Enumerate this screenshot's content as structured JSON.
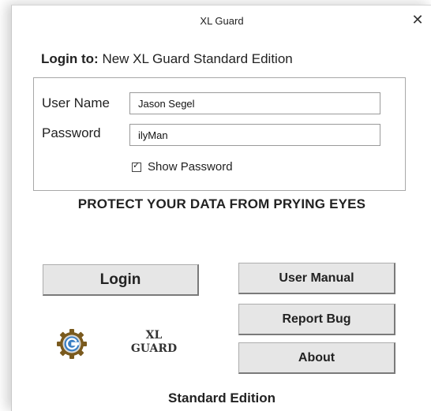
{
  "window": {
    "title": "XL Guard",
    "close_glyph": "✕"
  },
  "login_to": {
    "label": "Login to:",
    "target": "New XL Guard Standard Edition"
  },
  "form": {
    "username_label": "User Name",
    "username_value": "Jason Segel",
    "password_label": "Password",
    "password_value": "ilyMan",
    "show_password_label": "Show Password",
    "show_password_checked": true
  },
  "headline": "PROTECT YOUR DATA FROM PRYING EYES",
  "buttons": {
    "login": "Login",
    "user_manual": "User Manual",
    "report_bug": "Report Bug",
    "about": "About"
  },
  "logo": {
    "icon": "gear-g-icon",
    "line1": "XL",
    "line2": "GUARD"
  },
  "edition": "Standard Edition",
  "colors": {
    "button_face": "#e6e6e6",
    "gear_outer": "#7a5a1e",
    "gear_inner": "#3a7fc4"
  }
}
